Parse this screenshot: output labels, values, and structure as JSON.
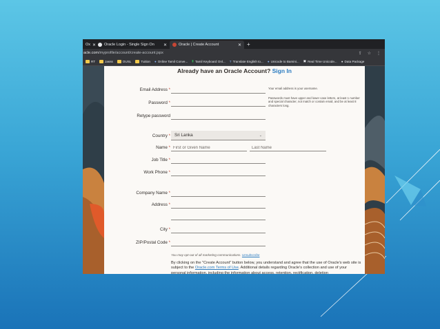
{
  "browser": {
    "tabs": [
      {
        "label": "Ox",
        "active": false
      },
      {
        "label": "Oracle Login - Single Sign On",
        "active": false
      },
      {
        "label": "Oracle | Create Account",
        "active": true
      }
    ],
    "new_tab": "+",
    "url_host": "acle.com",
    "url_path": "/myprofile/account/create-account.jspx",
    "bookmarks": [
      {
        "label": "RT",
        "icon": "folder-icon"
      },
      {
        "label": "Jasss",
        "icon": "folder-icon"
      },
      {
        "label": "OUSL",
        "icon": "folder-icon"
      },
      {
        "label": "Tuition",
        "icon": "folder-icon"
      },
      {
        "label": "Online Tamil Conve...",
        "icon": "globe-icon"
      },
      {
        "label": "Tamil Keyboard Onl...",
        "icon": "keyboard-icon"
      },
      {
        "label": "Translate English to...",
        "icon": "translate-icon"
      },
      {
        "label": "Unicode to Bamini...",
        "icon": "globe-icon"
      },
      {
        "label": "Real Time Unicode...",
        "icon": "doc-icon"
      },
      {
        "label": "Data Package",
        "icon": "globe-icon"
      }
    ]
  },
  "form": {
    "heading": "Already have an Oracle Account?",
    "sign_in": "Sign In",
    "required_mark": "*",
    "fields": {
      "email": {
        "label": "Email Address",
        "value": "",
        "hint": "Your email address is your username."
      },
      "password": {
        "label": "Password",
        "value": "",
        "hint": "Passwords must have upper and lower case letters, at least 1 number and special character, not match or contain email, and be at least 8 characters long."
      },
      "retype": {
        "label": "Retype password",
        "value": ""
      },
      "country": {
        "label": "Country",
        "value": "Sri Lanka"
      },
      "name": {
        "label": "Name",
        "first_placeholder": "First or Given Name",
        "last_placeholder": "Last Name"
      },
      "job_title": {
        "label": "Job Title",
        "value": ""
      },
      "work_phone": {
        "label": "Work Phone",
        "value": ""
      },
      "company": {
        "label": "Company Name",
        "value": ""
      },
      "address": {
        "label": "Address",
        "value": ""
      },
      "city": {
        "label": "City",
        "value": ""
      },
      "zip": {
        "label": "ZIP/Postal Code",
        "value": ""
      }
    },
    "optout_text": "You may opt-out of all marketing communications.",
    "unsubscribe": "Unsubscribe",
    "legal_1": "By clicking on the \"Create Account\" button below, you understand and agree that the use of Oracle's web site is subject to the",
    "terms_link": "Oracle.com Terms of Use",
    "legal_2": ". Additional details regarding Oracle's collection and use of your personal information, including the information about access, retention, rectification, deletion"
  }
}
